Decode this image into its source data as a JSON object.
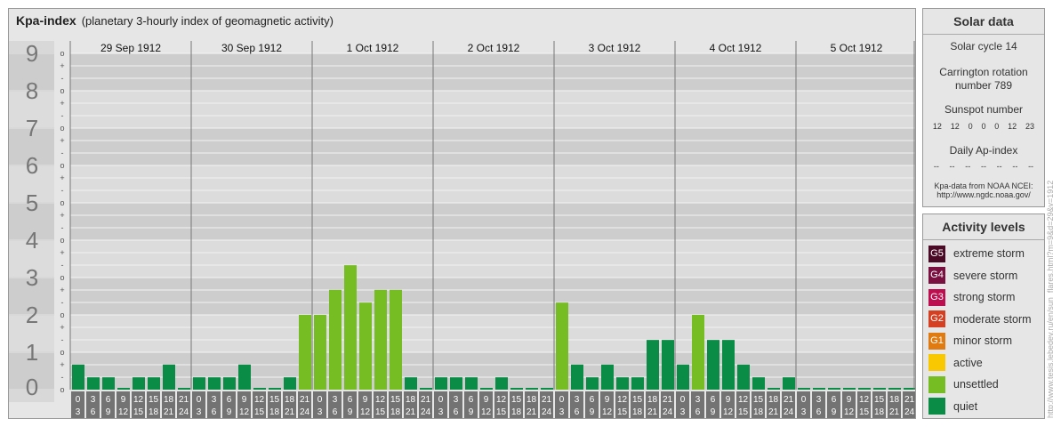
{
  "header": {
    "title": "Kpa-index",
    "subtitle": "(planetary 3-hourly index of geomagnetic activity)"
  },
  "chart_data": {
    "type": "bar",
    "title": "Kpa-index",
    "subtitle": "(planetary 3-hourly index of geomagnetic activity)",
    "ylim": [
      0,
      9
    ],
    "y_ticks": [
      "0",
      "1",
      "2",
      "3",
      "4",
      "5",
      "6",
      "7",
      "8",
      "9"
    ],
    "y_minor_labels": [
      "+",
      "o",
      "-"
    ],
    "days": [
      "29 Sep 1912",
      "30 Sep 1912",
      "1 Oct 1912",
      "2 Oct 1912",
      "3 Oct 1912",
      "4 Oct 1912",
      "5 Oct 1912"
    ],
    "interval_start": [
      "0",
      "3",
      "6",
      "9",
      "12",
      "15",
      "18",
      "21"
    ],
    "interval_end": [
      "3",
      "6",
      "9",
      "12",
      "15",
      "18",
      "21",
      "24"
    ],
    "values": [
      [
        0.67,
        0.33,
        0.33,
        0,
        0.33,
        0.33,
        0.67,
        0
      ],
      [
        0.33,
        0.33,
        0.33,
        0.67,
        0,
        0,
        0.33,
        2.0
      ],
      [
        2.0,
        2.67,
        3.33,
        2.33,
        2.67,
        2.67,
        0.33,
        0
      ],
      [
        0.33,
        0.33,
        0.33,
        0,
        0.33,
        0,
        0,
        0
      ],
      [
        2.33,
        0.67,
        0.33,
        0.67,
        0.33,
        0.33,
        1.33,
        1.33
      ],
      [
        0.67,
        2.0,
        1.33,
        1.33,
        0.67,
        0.33,
        0,
        0.33
      ],
      [
        0,
        0,
        0,
        0,
        0,
        0,
        0,
        0
      ]
    ],
    "colors": {
      "quiet": "#0a8c46",
      "unsettled": "#76bd24",
      "active": "#f9c800",
      "G1": "#e07b12",
      "G2": "#d64022",
      "G3": "#bd0f4f",
      "G4": "#7a1040",
      "G5": "#4a0a25"
    }
  },
  "solar": {
    "title": "Solar data",
    "cycle": "Solar cycle 14",
    "carrington_1": "Carrington rotation",
    "carrington_2": "number 789",
    "sunspot_title": "Sunspot number",
    "sunspots": [
      "12",
      "12",
      "0",
      "0",
      "0",
      "12",
      "23"
    ],
    "ap_title": "Daily Ap-index",
    "ap": [
      "--",
      "--",
      "--",
      "--",
      "--",
      "--",
      "--"
    ],
    "source_1": "Kpa-data from NOAA NCEI:",
    "source_2": "http://www.ngdc.noaa.gov/"
  },
  "legend": {
    "title": "Activity levels",
    "items": [
      {
        "badge": "G5",
        "label": "extreme storm",
        "color": "#4a0a25"
      },
      {
        "badge": "G4",
        "label": "severe storm",
        "color": "#7a1040"
      },
      {
        "badge": "G3",
        "label": "strong storm",
        "color": "#bd0f4f"
      },
      {
        "badge": "G2",
        "label": "moderate storm",
        "color": "#d64022"
      },
      {
        "badge": "G1",
        "label": "minor storm",
        "color": "#e07b12"
      },
      {
        "badge": "",
        "label": "active",
        "color": "#f9c800"
      },
      {
        "badge": "",
        "label": "unsettled",
        "color": "#76bd24"
      },
      {
        "badge": "",
        "label": "quiet",
        "color": "#0a8c46"
      }
    ]
  },
  "credit": "http://www.tesis.lebedev.ru/en/sun_flares.html?m=9&d=29&y=1912"
}
